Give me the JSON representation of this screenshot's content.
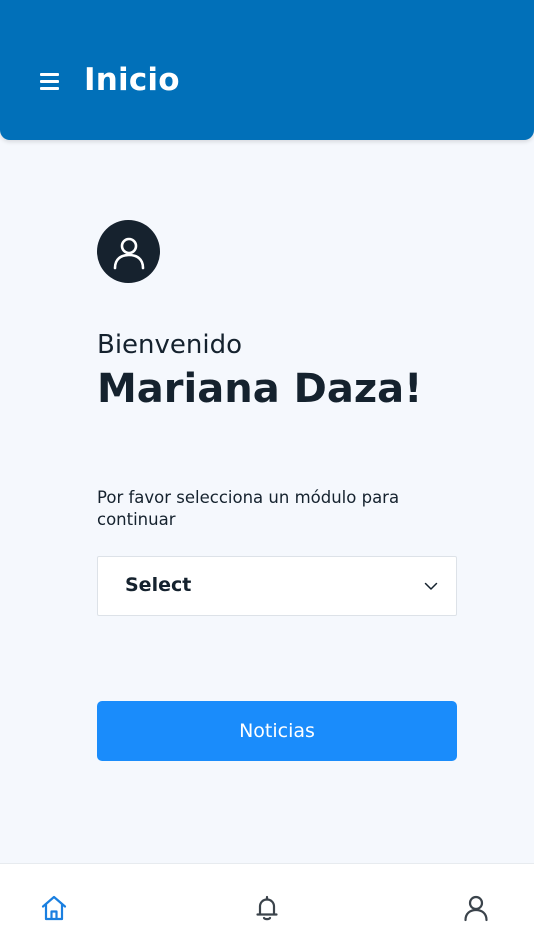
{
  "header": {
    "title": "Inicio",
    "menu_icon": "hamburger-menu-icon"
  },
  "profile": {
    "avatar_icon": "user-avatar-icon",
    "greeting": "Bienvenido",
    "name": "Mariana Daza!"
  },
  "module_picker": {
    "instruction": "Por favor selecciona un módulo para continuar",
    "selected_value": "Select",
    "chevron_icon": "chevron-down-icon"
  },
  "actions": {
    "primary_label": "Noticias"
  },
  "bottom_nav": {
    "items": [
      {
        "name": "home",
        "icon": "home-icon",
        "active": true
      },
      {
        "name": "notifications",
        "icon": "bell-icon",
        "active": false
      },
      {
        "name": "profile",
        "icon": "user-icon",
        "active": false
      }
    ]
  },
  "colors": {
    "header_bg": "#0170b9",
    "primary_button": "#1a8cfb",
    "active_nav": "#1a7fe0",
    "text_dark": "#15222e",
    "page_bg": "#f5f8fd"
  }
}
